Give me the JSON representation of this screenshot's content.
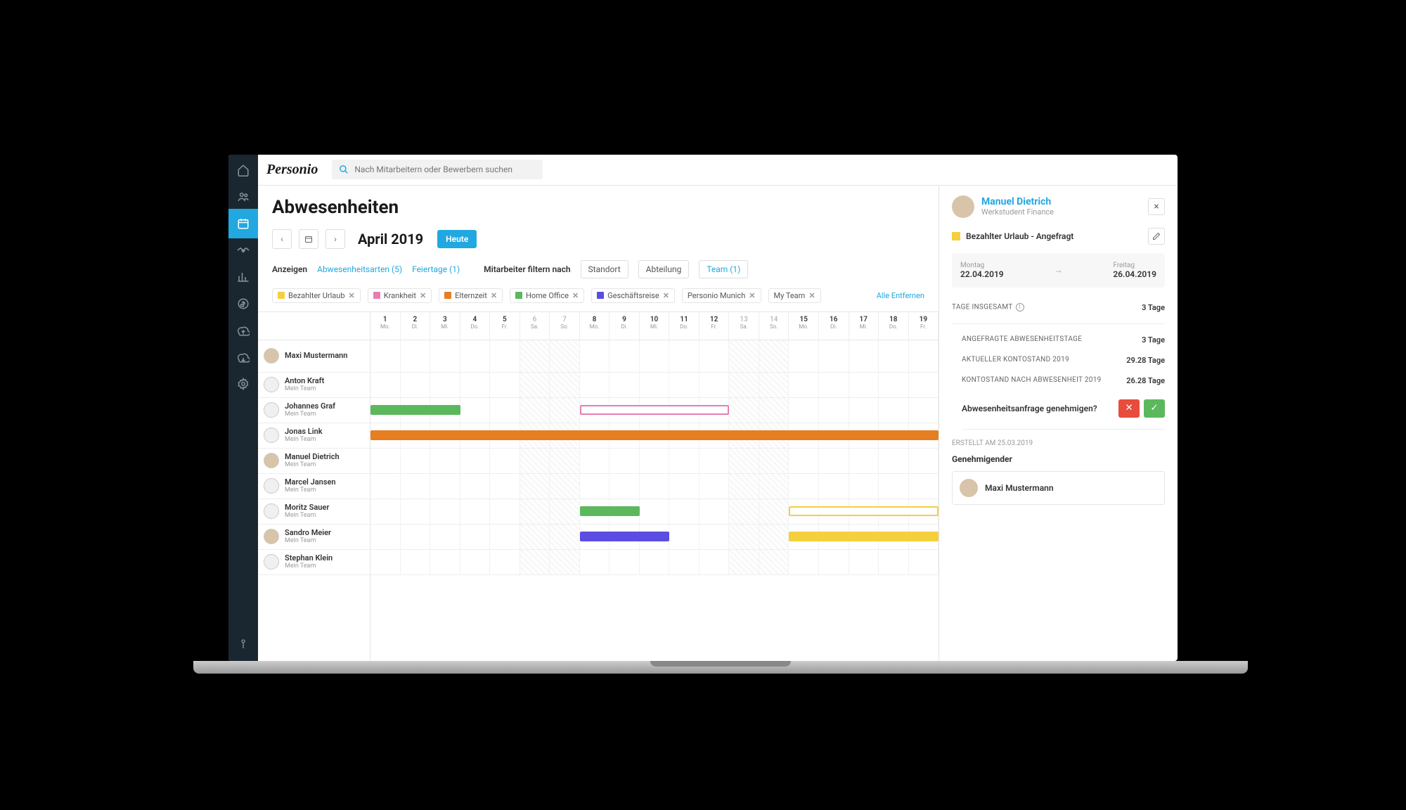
{
  "brand": "Personio",
  "search": {
    "placeholder": "Nach Mitarbeitern oder Bewerbern suchen"
  },
  "page": {
    "title": "Abwesenheiten",
    "month": "April 2019",
    "today_btn": "Heute"
  },
  "filters": {
    "show_label": "Anzeigen",
    "absence_types": "Abwesenheitsarten (5)",
    "holidays": "Feiertage (1)",
    "filter_by_label": "Mitarbeiter filtern nach",
    "location": "Standort",
    "department": "Abteilung",
    "team": "Team (1)"
  },
  "chips": [
    {
      "label": "Bezahlter Urlaub",
      "color": "#f4d03f"
    },
    {
      "label": "Krankheit",
      "color": "#e67eb3"
    },
    {
      "label": "Elternzeit",
      "color": "#e67e22"
    },
    {
      "label": "Home Office",
      "color": "#5cb85c"
    },
    {
      "label": "Geschäftsreise",
      "color": "#5b4ce2"
    },
    {
      "label": "Personio Munich",
      "color": null
    },
    {
      "label": "My Team",
      "color": null
    }
  ],
  "remove_all": "Alle Entfernen",
  "days": [
    {
      "n": "1",
      "d": "Mo."
    },
    {
      "n": "2",
      "d": "Di."
    },
    {
      "n": "3",
      "d": "Mi."
    },
    {
      "n": "4",
      "d": "Do."
    },
    {
      "n": "5",
      "d": "Fr."
    },
    {
      "n": "6",
      "d": "Sa.",
      "w": true
    },
    {
      "n": "7",
      "d": "So.",
      "w": true
    },
    {
      "n": "8",
      "d": "Mo."
    },
    {
      "n": "9",
      "d": "Di."
    },
    {
      "n": "10",
      "d": "Mi."
    },
    {
      "n": "11",
      "d": "Do."
    },
    {
      "n": "12",
      "d": "Fr."
    },
    {
      "n": "13",
      "d": "Sa.",
      "w": true
    },
    {
      "n": "14",
      "d": "So.",
      "w": true
    },
    {
      "n": "15",
      "d": "Mo."
    },
    {
      "n": "16",
      "d": "Di."
    },
    {
      "n": "17",
      "d": "Mi."
    },
    {
      "n": "18",
      "d": "Do."
    },
    {
      "n": "19",
      "d": "Fr."
    }
  ],
  "employees": [
    {
      "name": "Maxi Mustermann",
      "team": null,
      "avatar": "photo",
      "bars": []
    },
    {
      "name": "Anton Kraft",
      "team": "Mein Team",
      "avatar": "blank",
      "bars": []
    },
    {
      "name": "Johannes Graf",
      "team": "Mein Team",
      "avatar": "blank",
      "bars": [
        {
          "start": 1,
          "end": 3,
          "color": "#5cb85c",
          "fill": true
        },
        {
          "start": 8,
          "end": 12,
          "color": "#e67eb3",
          "fill": false
        }
      ]
    },
    {
      "name": "Jonas Link",
      "team": "Mein Team",
      "avatar": "blank",
      "bars": [
        {
          "start": 1,
          "end": 19,
          "color": "#e67e22",
          "fill": true
        }
      ]
    },
    {
      "name": "Manuel Dietrich",
      "team": "Mein Team",
      "avatar": "photo",
      "bars": []
    },
    {
      "name": "Marcel Jansen",
      "team": "Mein Team",
      "avatar": "blank",
      "bars": []
    },
    {
      "name": "Moritz Sauer",
      "team": "Mein Team",
      "avatar": "blank",
      "bars": [
        {
          "start": 8,
          "end": 9,
          "color": "#5cb85c",
          "fill": true
        },
        {
          "start": 15,
          "end": 19,
          "color": "#f4d03f",
          "fill": false
        }
      ]
    },
    {
      "name": "Sandro Meier",
      "team": "Mein Team",
      "avatar": "photo",
      "bars": [
        {
          "start": 8,
          "end": 10,
          "color": "#5b4ce2",
          "fill": true
        },
        {
          "start": 15,
          "end": 19,
          "color": "#f4d03f",
          "fill": true
        }
      ]
    },
    {
      "name": "Stephan Klein",
      "team": "Mein Team",
      "avatar": "blank",
      "bars": []
    }
  ],
  "panel": {
    "user_name": "Manuel Dietrich",
    "user_role": "Werkstudent Finance",
    "status": "Bezahlter Urlaub - Angefragt",
    "from_label": "Montag",
    "from_date": "22.04.2019",
    "to_label": "Freitag",
    "to_date": "26.04.2019",
    "total_label": "TAGE INSGESAMT",
    "total_value": "3 Tage",
    "requested_label": "ANGEFRAGTE ABWESENHEITSTAGE",
    "requested_value": "3 Tage",
    "balance_label": "AKTUELLER KONTOSTAND 2019",
    "balance_value": "29.28 Tage",
    "after_label": "KONTOSTAND NACH ABWESENHEIT 2019",
    "after_value": "26.28 Tage",
    "approve_question": "Abwesenheitsanfrage genehmigen?",
    "created": "ERSTELLT AM 25.03.2019",
    "approver_title": "Genehmigender",
    "approver_name": "Maxi Mustermann"
  }
}
